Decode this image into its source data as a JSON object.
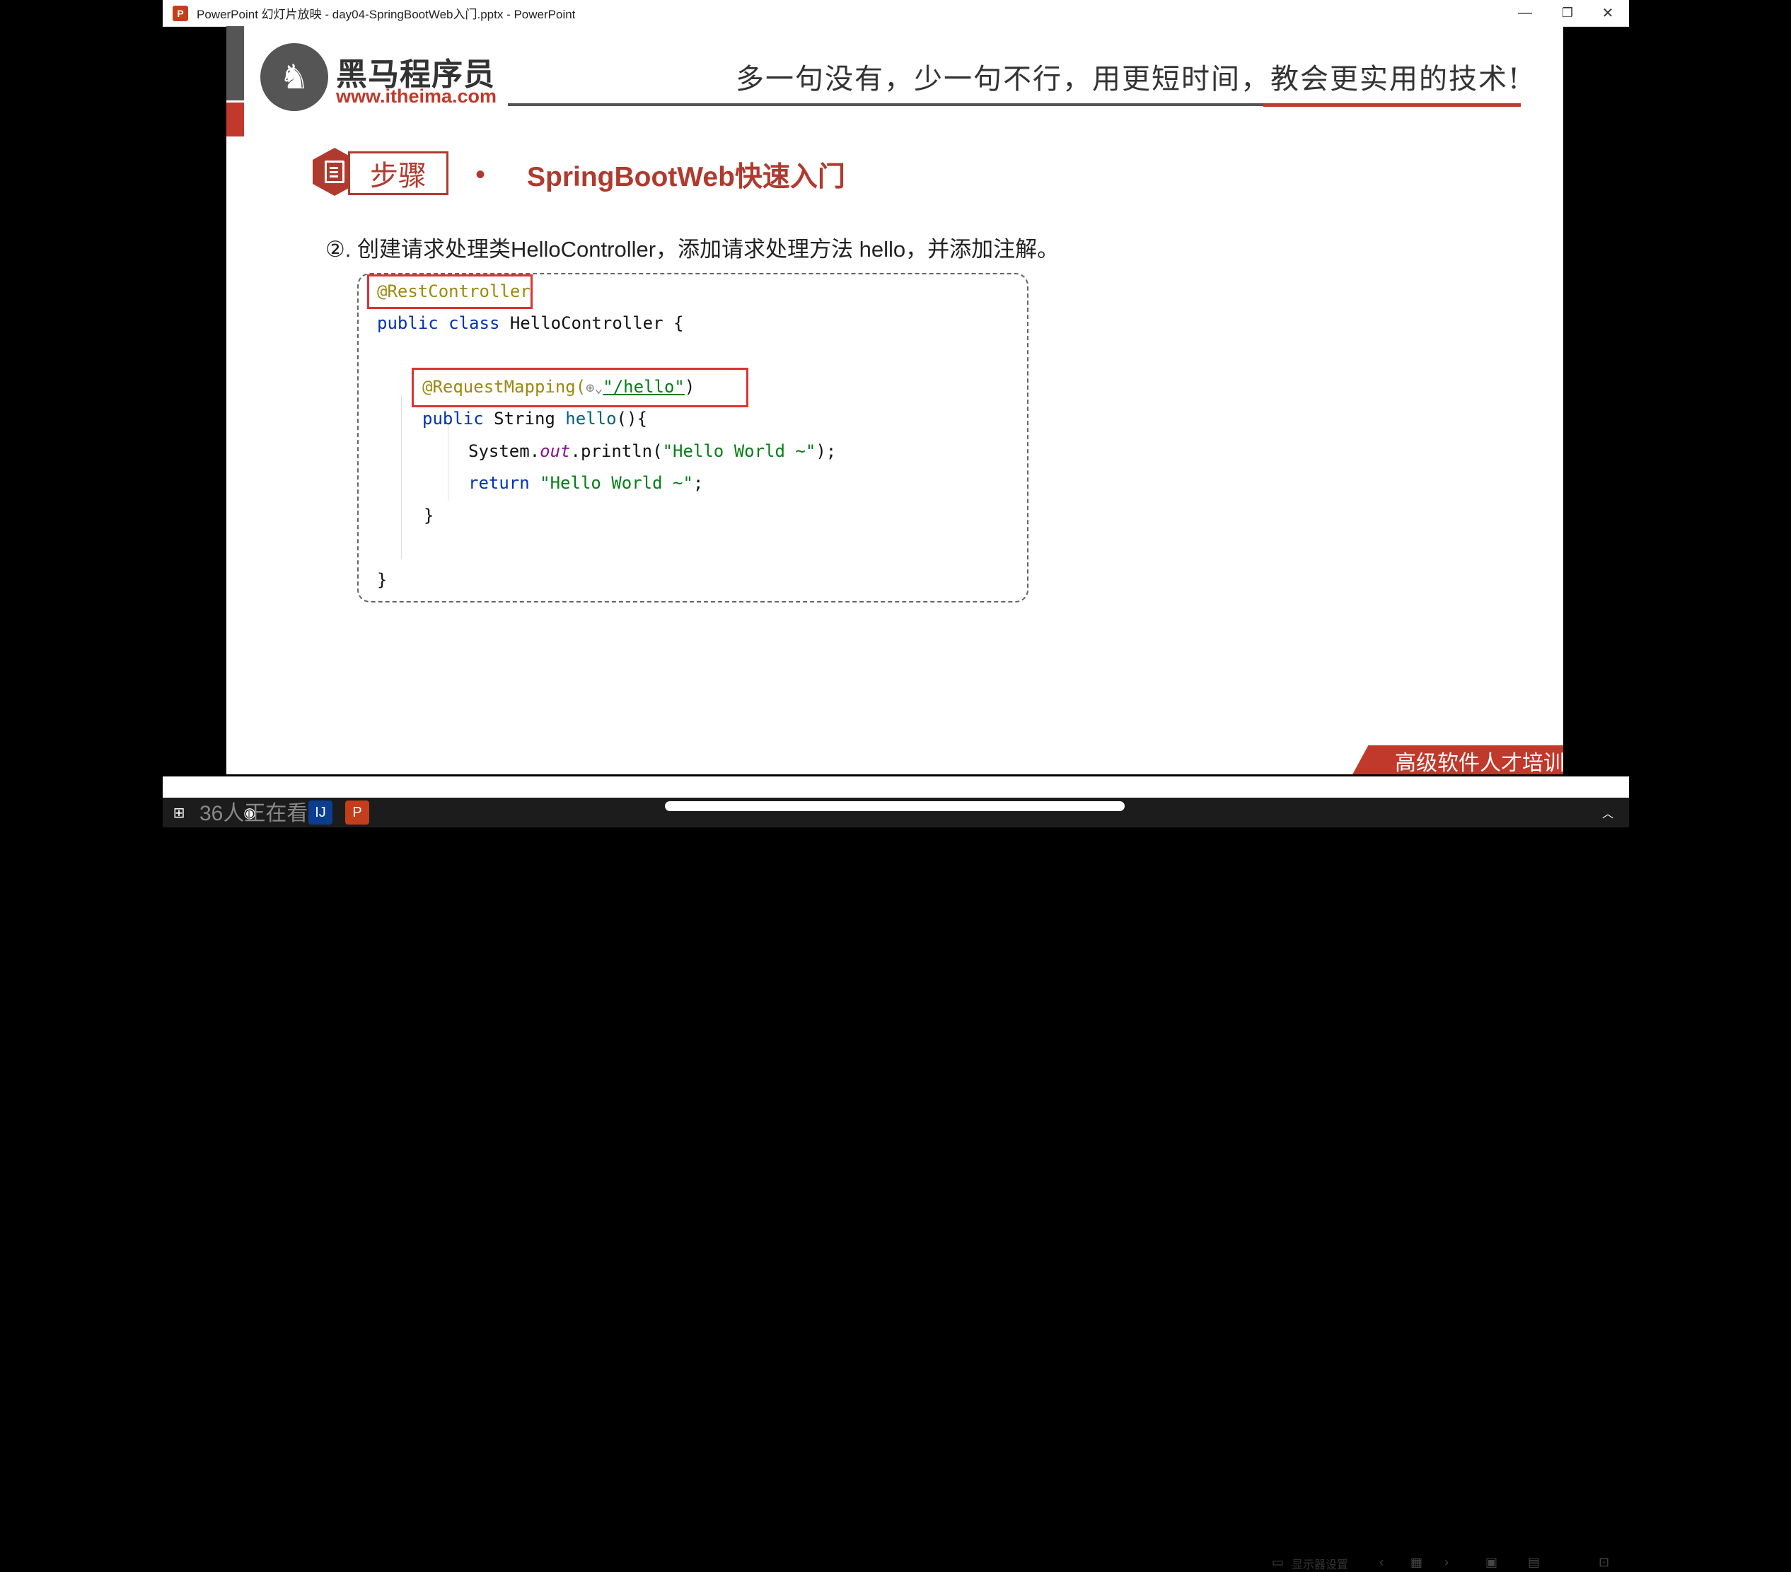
{
  "window": {
    "app_icon": "P",
    "title": "PowerPoint 幻灯片放映  -  day04-SpringBootWeb入门.pptx - PowerPoint",
    "minimize_icon": "—",
    "restore_icon": "❐",
    "close_icon": "✕"
  },
  "slide": {
    "logo": {
      "name": "黑马程序员",
      "url": "www.itheima.com"
    },
    "slogan": "多一句没有，少一句不行，用更短时间，教会更实用的技术!",
    "step_label": "步骤",
    "bullet": "•",
    "heading": "SpringBootWeb快速入门",
    "instruction": "②. 创建请求处理类HelloController，添加请求处理方法 hello，并添加注解。",
    "code": {
      "ann_rest": "@RestController",
      "line2_kw": "public class",
      "line2_rest": " HelloController {",
      "ann_req": "@RequestMapping(",
      "ann_req_path": "\"/hello\"",
      "ann_req_close": ")",
      "line5_kw": "public",
      "line5_rest": " String ",
      "line5_method": "hello",
      "line5_end": "(){",
      "line6_pre": "System.",
      "line6_field": "out",
      "line6_mid": ".println(",
      "line6_str": "\"Hello World ~\"",
      "line6_end": ");",
      "line7_kw": "return",
      "line7_str": " \"Hello World ~\"",
      "line7_end": ";",
      "close_inner": "}",
      "close_outer": "}"
    },
    "banner": "高级软件人才培训专家"
  },
  "statusbar": {
    "display_settings": "显示器设置"
  },
  "taskbar": {
    "watching": "36人正在看"
  },
  "colors": {
    "brand_red": "#c0392b",
    "annotation": "#9e880d",
    "keyword": "#0033b3",
    "string": "#067d17"
  }
}
